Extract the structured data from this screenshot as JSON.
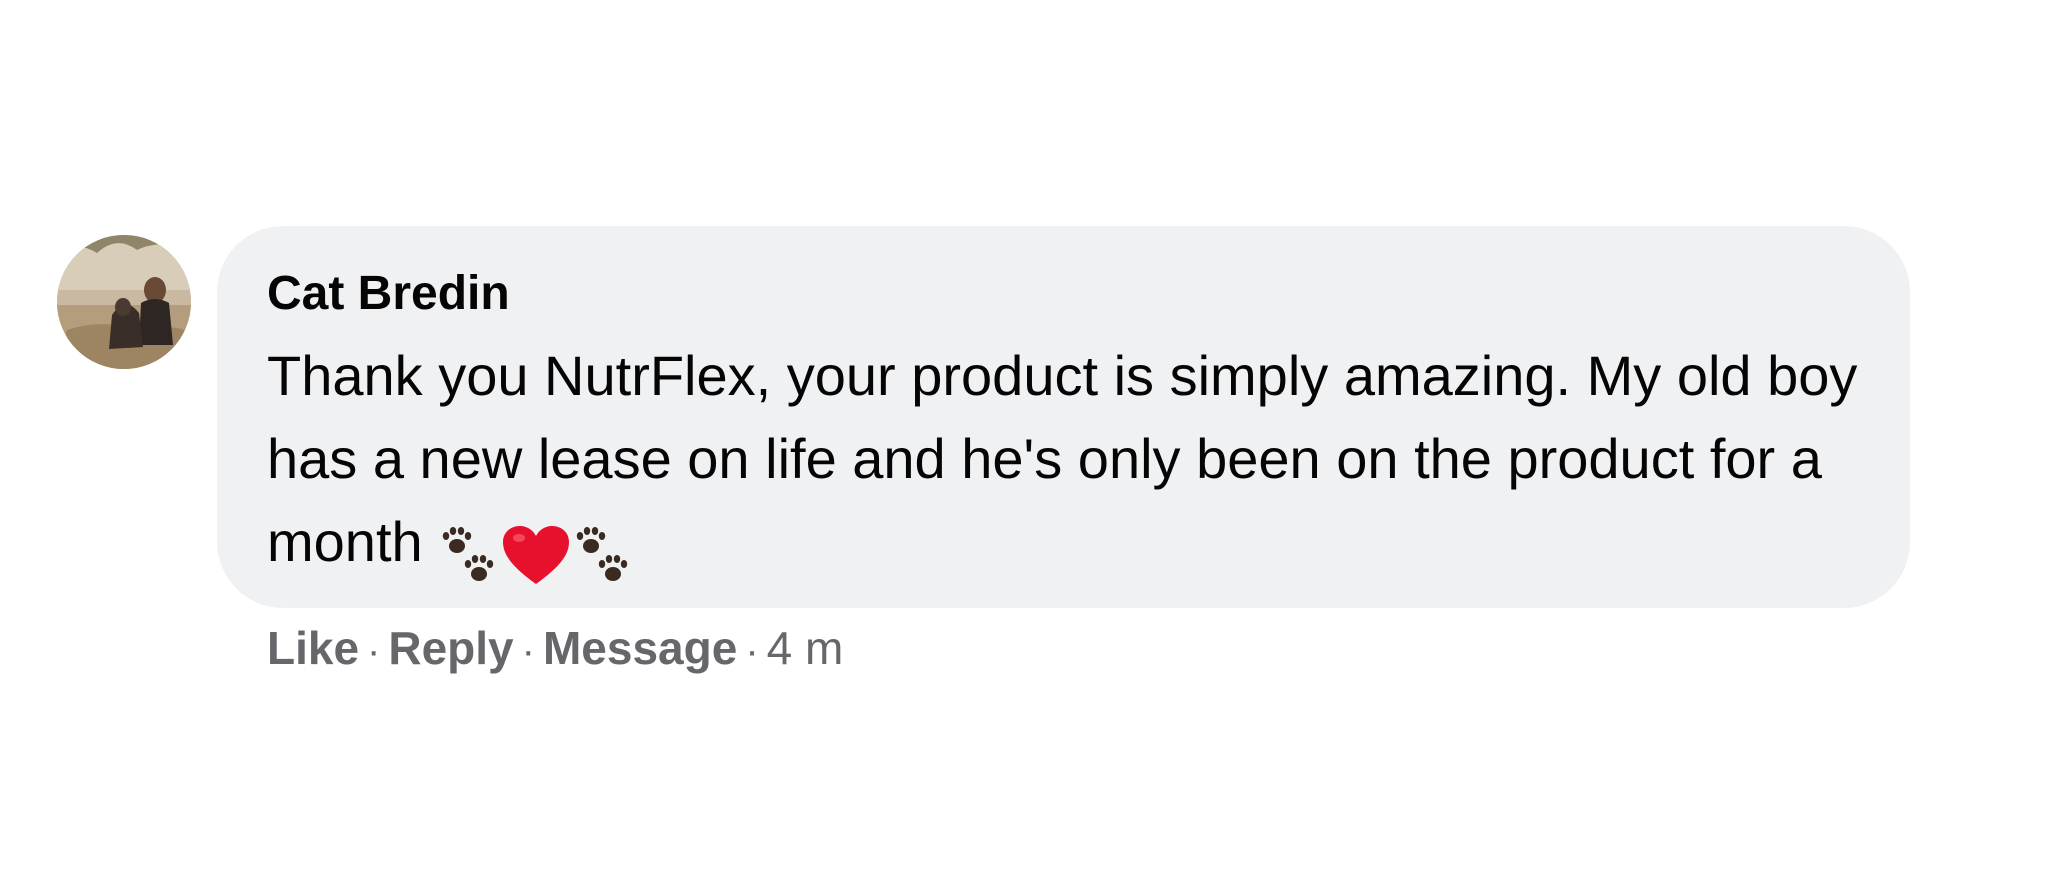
{
  "comment": {
    "author": "Cat Bredin",
    "text": "Thank you NutrFlex, your product is simply amazing. My old boy has a new lease on life and he's only been on the product for a month",
    "emojis": [
      "paw-prints-icon",
      "red-heart-icon",
      "paw-prints-icon"
    ],
    "actions": {
      "like_label": "Like",
      "reply_label": "Reply",
      "message_label": "Message",
      "separator": "·",
      "timestamp": "4 m"
    }
  },
  "colors": {
    "bubble_background": "#f0f1f3",
    "text_primary": "#050505",
    "text_secondary": "#65676b",
    "heart": "#e8112d",
    "paw": "#3b2a22"
  }
}
